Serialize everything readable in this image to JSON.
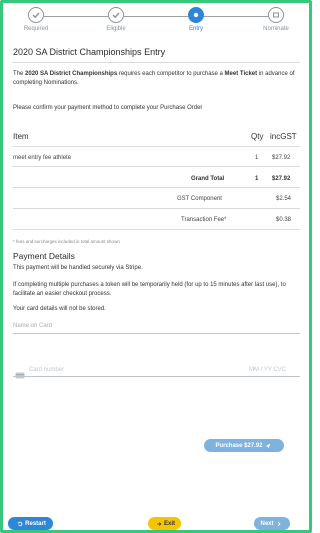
{
  "stepper": {
    "steps": [
      {
        "label": "Required",
        "icon": "check-icon"
      },
      {
        "label": "Eligible",
        "icon": "check-icon"
      },
      {
        "label": "Entry",
        "icon": "entry-icon"
      },
      {
        "label": "Nominate",
        "icon": "nominate-icon"
      }
    ],
    "active_index": 2
  },
  "page": {
    "title": "2020 SA District Championships Entry"
  },
  "intro": {
    "prefix": "The ",
    "event_bold": "2020 SA District Championships",
    "middle": " requires each competitor to purchase a ",
    "ticket_bold": "Meet Ticket",
    "suffix": " in advance of completing Nominations."
  },
  "confirm_text": "Please confirm your payment method to complete your Purchase Order",
  "order_table": {
    "headers": {
      "item": "Item",
      "qty": "Qty",
      "inc_gst": "incGST"
    },
    "rows": [
      {
        "item": "meet entry fee athlete",
        "qty": "1",
        "price": "$27.92"
      }
    ],
    "grand_total": {
      "label": "Grand Total",
      "qty": "1",
      "price": "$27.92"
    },
    "gst": {
      "label": "GST Component",
      "price": "$2.54"
    },
    "fee": {
      "label": "Transaction Fee*",
      "price": "$0.38"
    },
    "footnote": "* fees and surcharges included in total amount shown"
  },
  "payment": {
    "heading": "Payment Details",
    "stripe_note": "This payment will be handled securely via Stripe.",
    "token_note": "If completing multiple purchases a token will be temporarily held (for up to 15 minutes after last use), to facilitate an easier checkout process.",
    "storage_note": "Your card details will not be stored.",
    "name_placeholder": "Name on Card",
    "card_placeholder": "Card number",
    "expiry_placeholder": "MM / YY  CVC",
    "purchase_label": "Purchase $27.92"
  },
  "footer": {
    "restart_label": "Restart",
    "exit_label": "Exit",
    "next_label": "Next"
  },
  "colors": {
    "frame_border": "#35c97b",
    "active_blue": "#2f86d6",
    "purchase_button": "#7fb2dc",
    "restart_button": "#2f86d6",
    "exit_button": "#f6c400",
    "next_button": "#7fb2dc"
  }
}
